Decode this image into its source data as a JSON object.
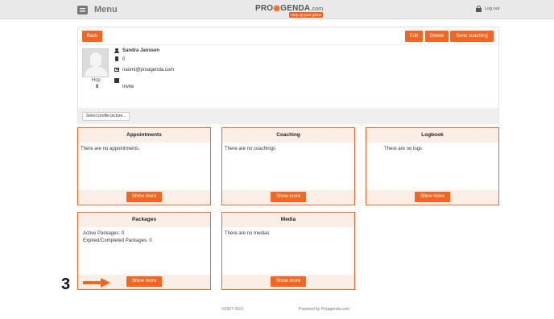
{
  "header": {
    "menu_label": "Menu",
    "logo_text_1": "PRO",
    "logo_text_2": "GENDA",
    "logo_suffix": ".com",
    "tagline": "Step up your game",
    "logout_label": "Log out"
  },
  "toolbar": {
    "back_label": "Back",
    "edit_label": "Edit",
    "delete_label": "Delete",
    "send_coaching_label": "Send coaching"
  },
  "profile": {
    "name": "Sandra Janssen",
    "phone": "0",
    "email": "naomi@proagenda.com",
    "date": "",
    "invite_label": "Invite",
    "hcp_label": "Hcp",
    "hcp_value": "0",
    "select_picture_label": "Select profile picture..."
  },
  "panels": {
    "appointments": {
      "title": "Appointments",
      "body": "There are no appointments.",
      "button": "Show more"
    },
    "coaching": {
      "title": "Coaching",
      "body": "There are no coachings",
      "button": "Show more"
    },
    "logbook": {
      "title": "Logbook",
      "body": "There are no logs",
      "button": "Show more"
    },
    "packages": {
      "title": "Packages",
      "line1": "Active Packages: 0",
      "line2": "Expired/Completed Packages: 0",
      "button": "Show more"
    },
    "media": {
      "title": "Media",
      "body": "There are no medias",
      "button": "Show more"
    }
  },
  "annotation": {
    "step_number": "3"
  },
  "footer": {
    "copyright": "©2007-2021",
    "powered_by": "Powered by Proagenda.com"
  },
  "colors": {
    "accent": "#f26522",
    "panel_header_bg": "#fbeee6",
    "topbar_bg": "#e9e9e9"
  }
}
